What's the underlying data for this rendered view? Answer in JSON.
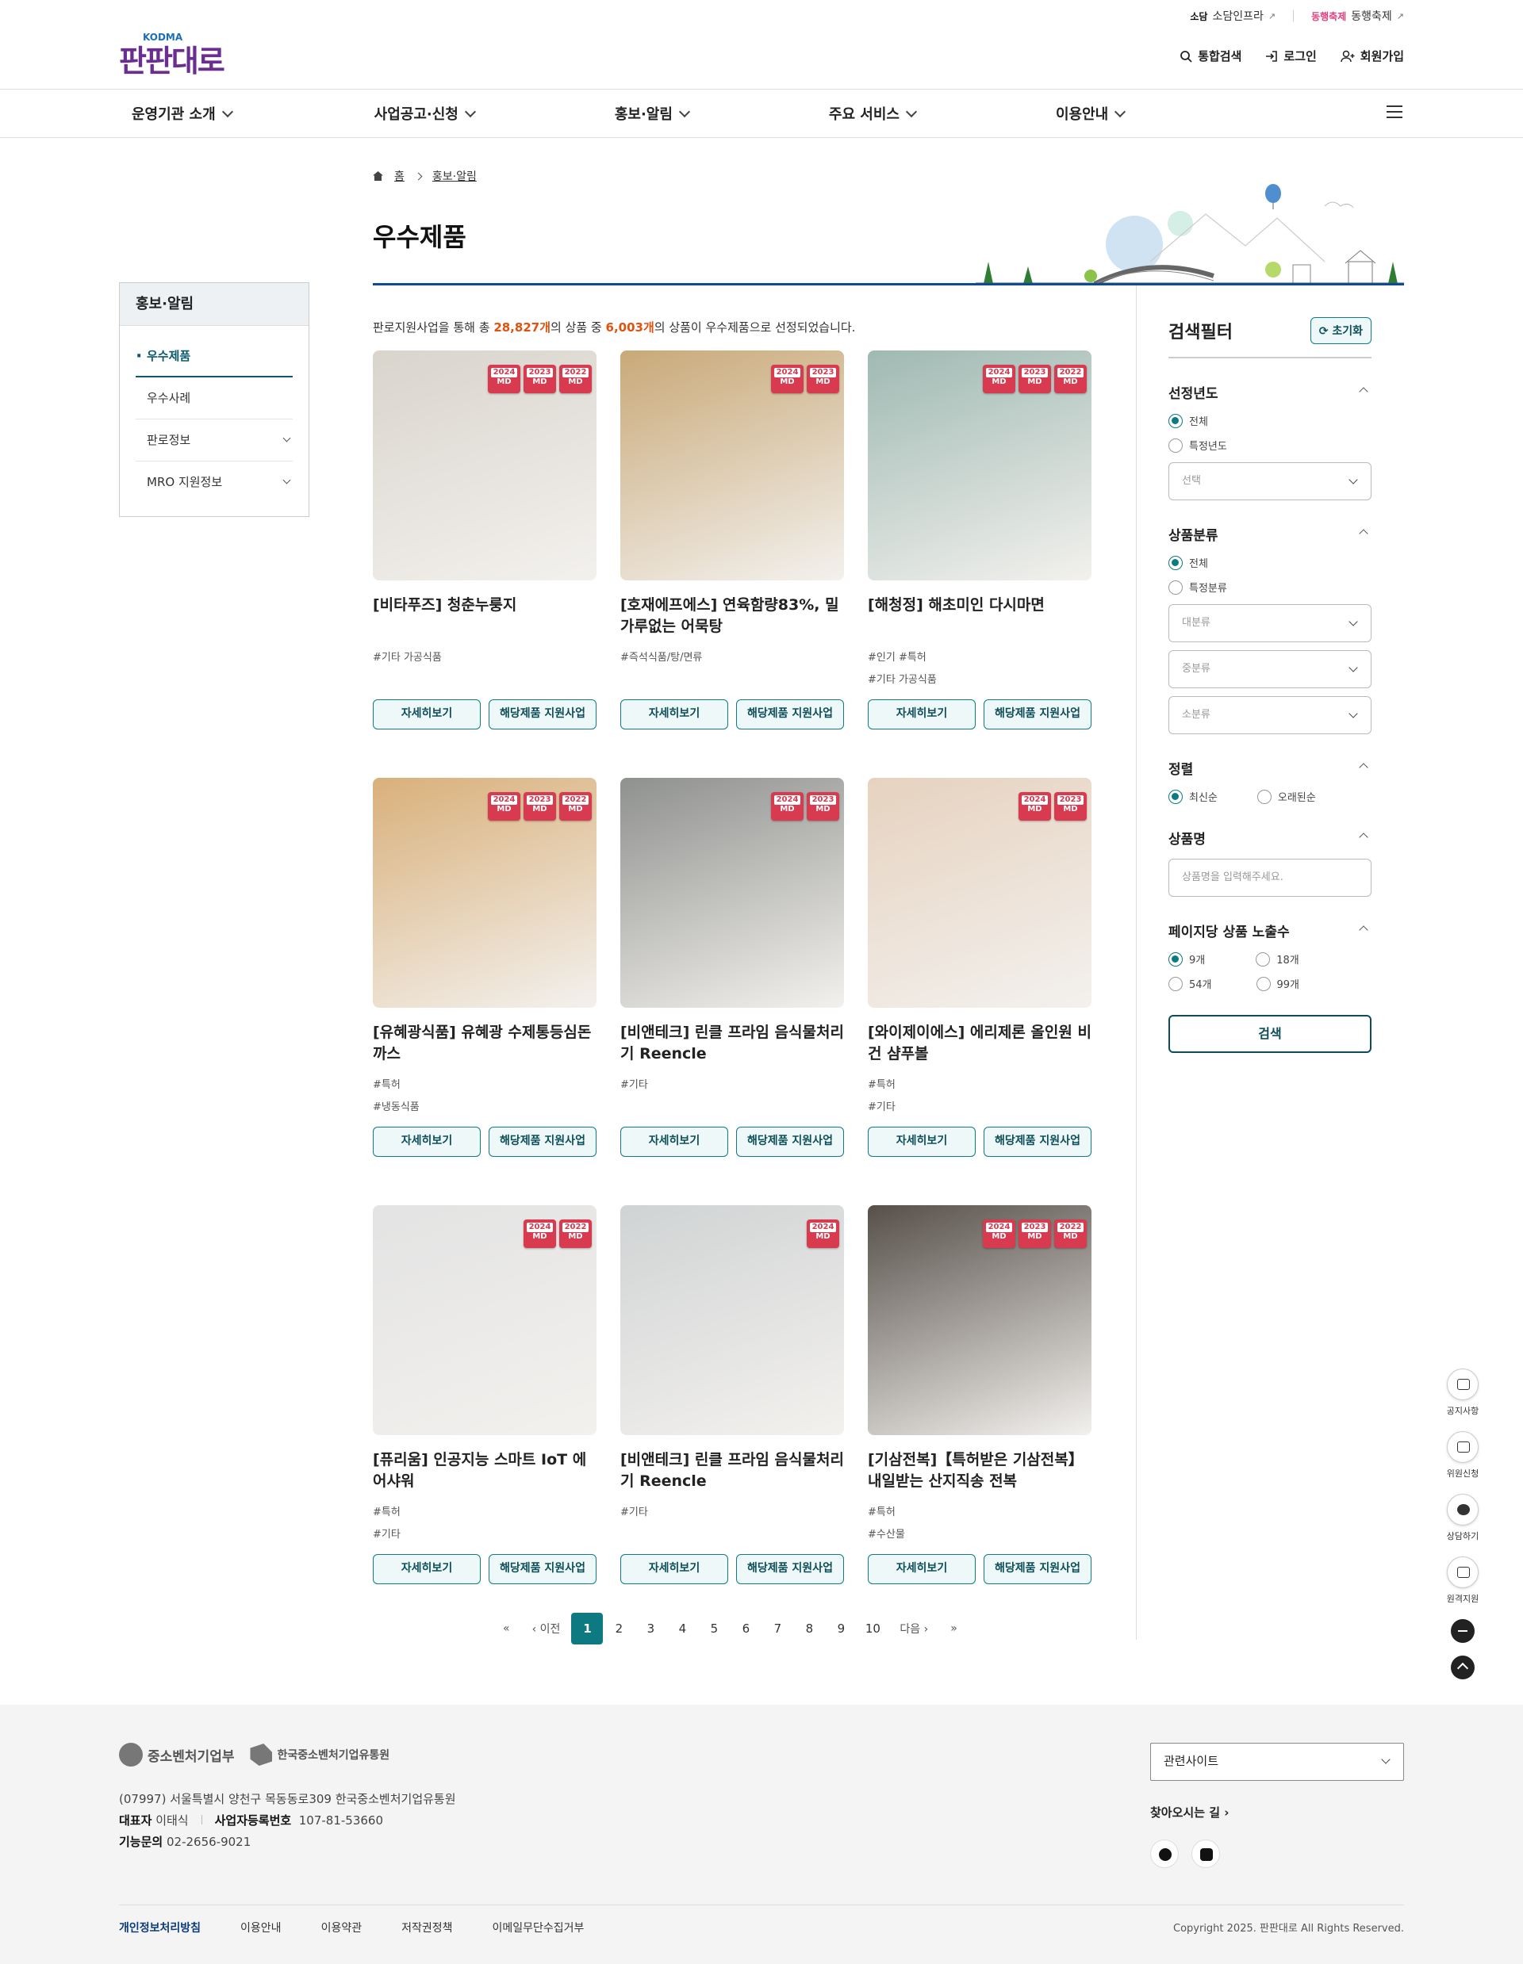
{
  "util_links": {
    "item1_logo": "소담",
    "item1_label": "소담인프라",
    "item2_logo": "동행축제",
    "item2_label": "동행축제"
  },
  "header": {
    "logo_text": "판판대로",
    "logo_sub": "KODMA",
    "search_label": "통합검색",
    "login_label": "로그인",
    "signup_label": "회원가입"
  },
  "gnb": [
    "운영기관 소개",
    "사업공고·신청",
    "홍보·알림",
    "주요 서비스",
    "이용안내"
  ],
  "lnb": {
    "title": "홍보·알림",
    "items": [
      {
        "label": "우수제품",
        "active": true
      },
      {
        "label": "우수사례"
      },
      {
        "label": "판로정보"
      },
      {
        "label": "MRO 지원정보"
      }
    ]
  },
  "breadcrumb": {
    "home": "홈",
    "current": "홍보·알림"
  },
  "page_title": "우수제품",
  "summary": {
    "pre": "판로지원사업을 통해 총 ",
    "total": "28,827개",
    "mid": "의 상품 중 ",
    "selected": "6,003개",
    "post": "의 상품이 우수제품으로 선정되었습니다."
  },
  "card_buttons": {
    "detail": "자세히보기",
    "support": "해당제품 지원사업"
  },
  "badge_label": "MD",
  "products": [
    {
      "name": "[비타푸즈] 청춘누룽지",
      "tags": [
        "#기타 가공식품"
      ],
      "badges": [
        "2024",
        "2023",
        "2022"
      ],
      "color": "#d9d4cc"
    },
    {
      "name": "[호재에프에스] 연육함량83%, 밀가루없는 어묵탕",
      "tags": [
        "#즉석식품/탕/면류"
      ],
      "badges": [
        "2024",
        "2023"
      ],
      "color": "#c9a978"
    },
    {
      "name": "[해청정] 해초미인 다시마면",
      "tags": [
        "#인기 #특허",
        "#기타 가공식품"
      ],
      "badges": [
        "2024",
        "2023",
        "2022"
      ],
      "color": "#9fb9b2"
    },
    {
      "name": "[유혜광식품] 유혜광 수제통등심돈까스",
      "tags": [
        "#특허",
        "#냉동식품"
      ],
      "badges": [
        "2024",
        "2023",
        "2022"
      ],
      "color": "#d9b07a"
    },
    {
      "name": "[비앤테크] 린클 프라임 음식물처리기 Reencle",
      "tags": [
        "#기타"
      ],
      "badges": [
        "2024",
        "2023"
      ],
      "color": "#8f918e"
    },
    {
      "name": "[와이제이에스] 에리제론 올인원 비건 샴푸볼",
      "tags": [
        "#특허",
        "#기타"
      ],
      "badges": [
        "2024",
        "2023"
      ],
      "color": "#e6d2bf"
    },
    {
      "name": "[퓨리움] 인공지능 스마트 IoT 에어샤워",
      "tags": [
        "#특허",
        "#기타"
      ],
      "badges": [
        "2024",
        "2022"
      ],
      "color": "#e3e3e3"
    },
    {
      "name": "[비앤테크] 린클 프라임 음식물처리기 Reencle",
      "tags": [
        "#기타"
      ],
      "badges": [
        "2024"
      ],
      "color": "#d0d3d4"
    },
    {
      "name": "[기삼전복]【특허받은 기삼전복】내일받는 산지직송 전복",
      "tags": [
        "#특허",
        "#수산물"
      ],
      "badges": [
        "2024",
        "2023",
        "2022"
      ],
      "color": "#57504a"
    }
  ],
  "pagination": {
    "prev": "이전",
    "next": "다음",
    "pages": [
      "1",
      "2",
      "3",
      "4",
      "5",
      "6",
      "7",
      "8",
      "9",
      "10"
    ],
    "current": "1"
  },
  "filter": {
    "title": "검색필터",
    "reset": "초기화",
    "year": {
      "title": "선정년도",
      "all": "전체",
      "specific": "특정년도",
      "select_placeholder": "선택"
    },
    "category": {
      "title": "상품분류",
      "all": "전체",
      "specific": "특정분류",
      "large": "대분류",
      "medium": "중분류",
      "small": "소분류"
    },
    "sort": {
      "title": "정렬",
      "newest": "최신순",
      "oldest": "오래된순"
    },
    "name": {
      "title": "상품명",
      "placeholder": "상품명을 입력해주세요."
    },
    "per_page": {
      "title": "페이지당 상품 노출수",
      "options": [
        "9개",
        "18개",
        "54개",
        "99개"
      ],
      "selected": "9개"
    },
    "search": "검색"
  },
  "quick_menu": [
    "공지사항",
    "위원신청",
    "상담하기",
    "원격지원"
  ],
  "footer": {
    "logo1": "중소벤처기업부",
    "logo2": "한국중소벤처기업유통원",
    "address": "(07997) 서울특별시 양천구 목동동로309 한국중소벤처기업유통원",
    "ceo_label": "대표자",
    "ceo": "이태식",
    "biz_label": "사업자등록번호",
    "biz": "107-81-53660",
    "tel_label": "기능문의",
    "tel": "02-2656-9021",
    "related": "관련사이트",
    "directions": "찾아오시는 길",
    "links": [
      "개인정보처리방침",
      "이용안내",
      "이용약관",
      "저작권정책",
      "이메일무단수집거부"
    ],
    "copyright": "Copyright 2025. 판판대로 All Rights Reserved."
  }
}
